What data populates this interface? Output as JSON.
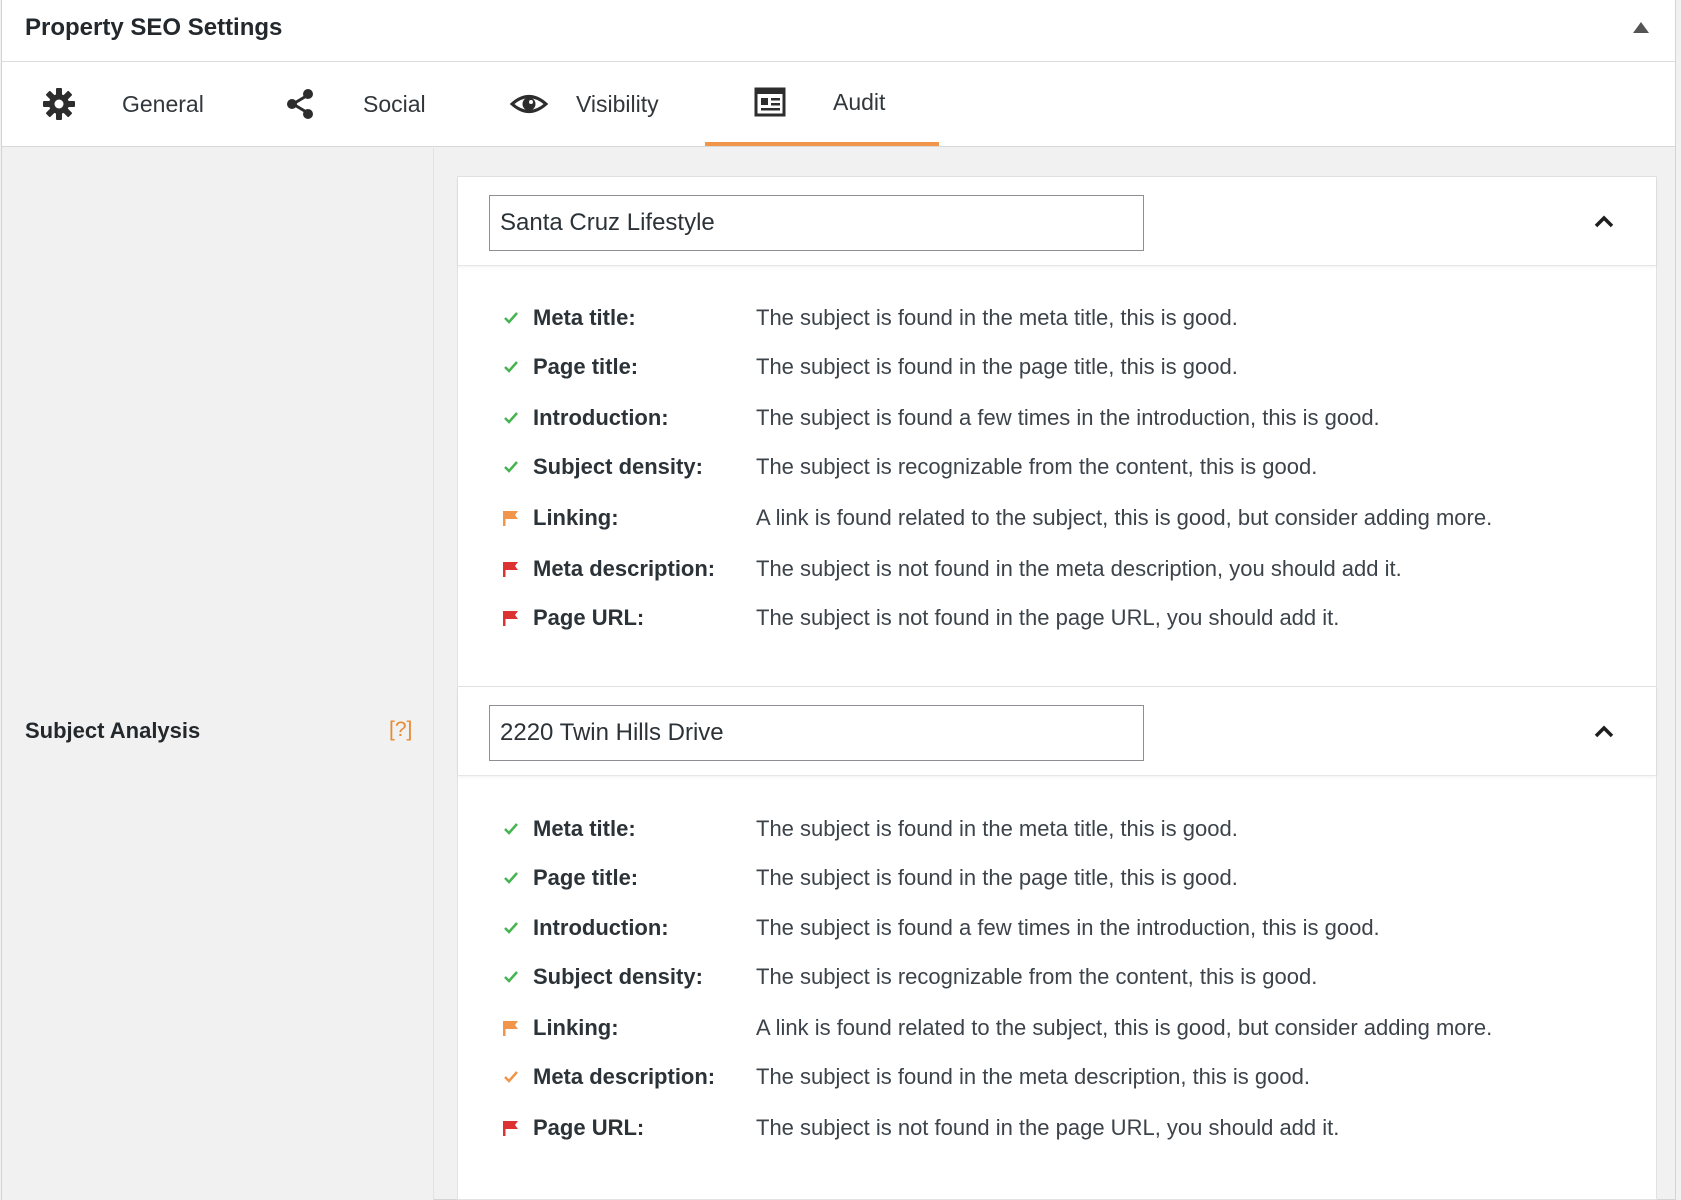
{
  "panel": {
    "title": "Property SEO Settings"
  },
  "tabs": [
    {
      "label": "General",
      "icon": "gear-icon"
    },
    {
      "label": "Social",
      "icon": "share-icon"
    },
    {
      "label": "Visibility",
      "icon": "eye-icon"
    },
    {
      "label": "Audit",
      "icon": "audit-icon",
      "active": true
    }
  ],
  "sidebar": {
    "label": "Subject Analysis",
    "help": "[?]"
  },
  "colors": {
    "accent": "#f0954a",
    "good": "#46b450",
    "warning": "#f0954a",
    "bad": "#dc3232"
  },
  "subjects": [
    {
      "value": "Santa Cruz Lifestyle",
      "checks": [
        {
          "status": "good",
          "label": "Meta title:",
          "message": "The subject is found in the meta title, this is good."
        },
        {
          "status": "good",
          "label": "Page title:",
          "message": "The subject is found in the page title, this is good."
        },
        {
          "status": "good",
          "label": "Introduction:",
          "message": "The subject is found a few times in the introduction, this is good."
        },
        {
          "status": "good",
          "label": "Subject density:",
          "message": "The subject is recognizable from the content, this is good."
        },
        {
          "status": "warning",
          "label": "Linking:",
          "message": "A link is found related to the subject, this is good, but consider adding more."
        },
        {
          "status": "bad",
          "label": "Meta description:",
          "message": "The subject is not found in the meta description, you should add it."
        },
        {
          "status": "bad",
          "label": "Page URL:",
          "message": "The subject is not found in the page URL, you should add it."
        }
      ]
    },
    {
      "value": "2220 Twin Hills Drive",
      "checks": [
        {
          "status": "good",
          "label": "Meta title:",
          "message": "The subject is found in the meta title, this is good."
        },
        {
          "status": "good",
          "label": "Page title:",
          "message": "The subject is found in the page title, this is good."
        },
        {
          "status": "good",
          "label": "Introduction:",
          "message": "The subject is found a few times in the introduction, this is good."
        },
        {
          "status": "good",
          "label": "Subject density:",
          "message": "The subject is recognizable from the content, this is good."
        },
        {
          "status": "warning",
          "label": "Linking:",
          "message": "A link is found related to the subject, this is good, but consider adding more."
        },
        {
          "status": "ok",
          "label": "Meta description:",
          "message": "The subject is found in the meta description, this is good."
        },
        {
          "status": "bad",
          "label": "Page URL:",
          "message": "The subject is not found in the page URL, you should add it."
        }
      ]
    }
  ]
}
